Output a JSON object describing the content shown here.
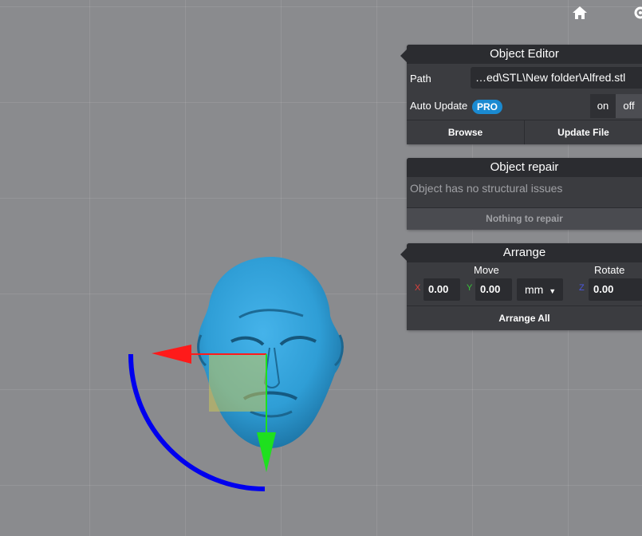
{
  "toolbar": {
    "home_icon": "home-icon",
    "settings_icon": "gear-icon"
  },
  "object_editor": {
    "title": "Object Editor",
    "path_label": "Path",
    "path_value": "…ed\\STL\\New folder\\Alfred.stl",
    "auto_update_label": "Auto Update",
    "pro_badge": "PRO",
    "toggle_on": "on",
    "toggle_off": "off",
    "browse_button": "Browse",
    "update_file_button": "Update File"
  },
  "object_repair": {
    "title": "Object repair",
    "message": "Object has no structural issues",
    "button": "Nothing to repair"
  },
  "arrange": {
    "title": "Arrange",
    "move_label": "Move",
    "rotate_label": "Rotate",
    "x_label": "X",
    "x_value": "0.00",
    "y_label": "Y",
    "y_value": "0.00",
    "unit": "mm",
    "z_label": "Z",
    "z_value": "0.00",
    "arrange_all_button": "Arrange All"
  },
  "colors": {
    "x_axis": "#ff1a1a",
    "y_axis": "#1ee01e",
    "z_axis": "#0000ee",
    "model": "#2f9ed6",
    "panel": "#3b3c40",
    "accent": "#1a8ad1"
  }
}
